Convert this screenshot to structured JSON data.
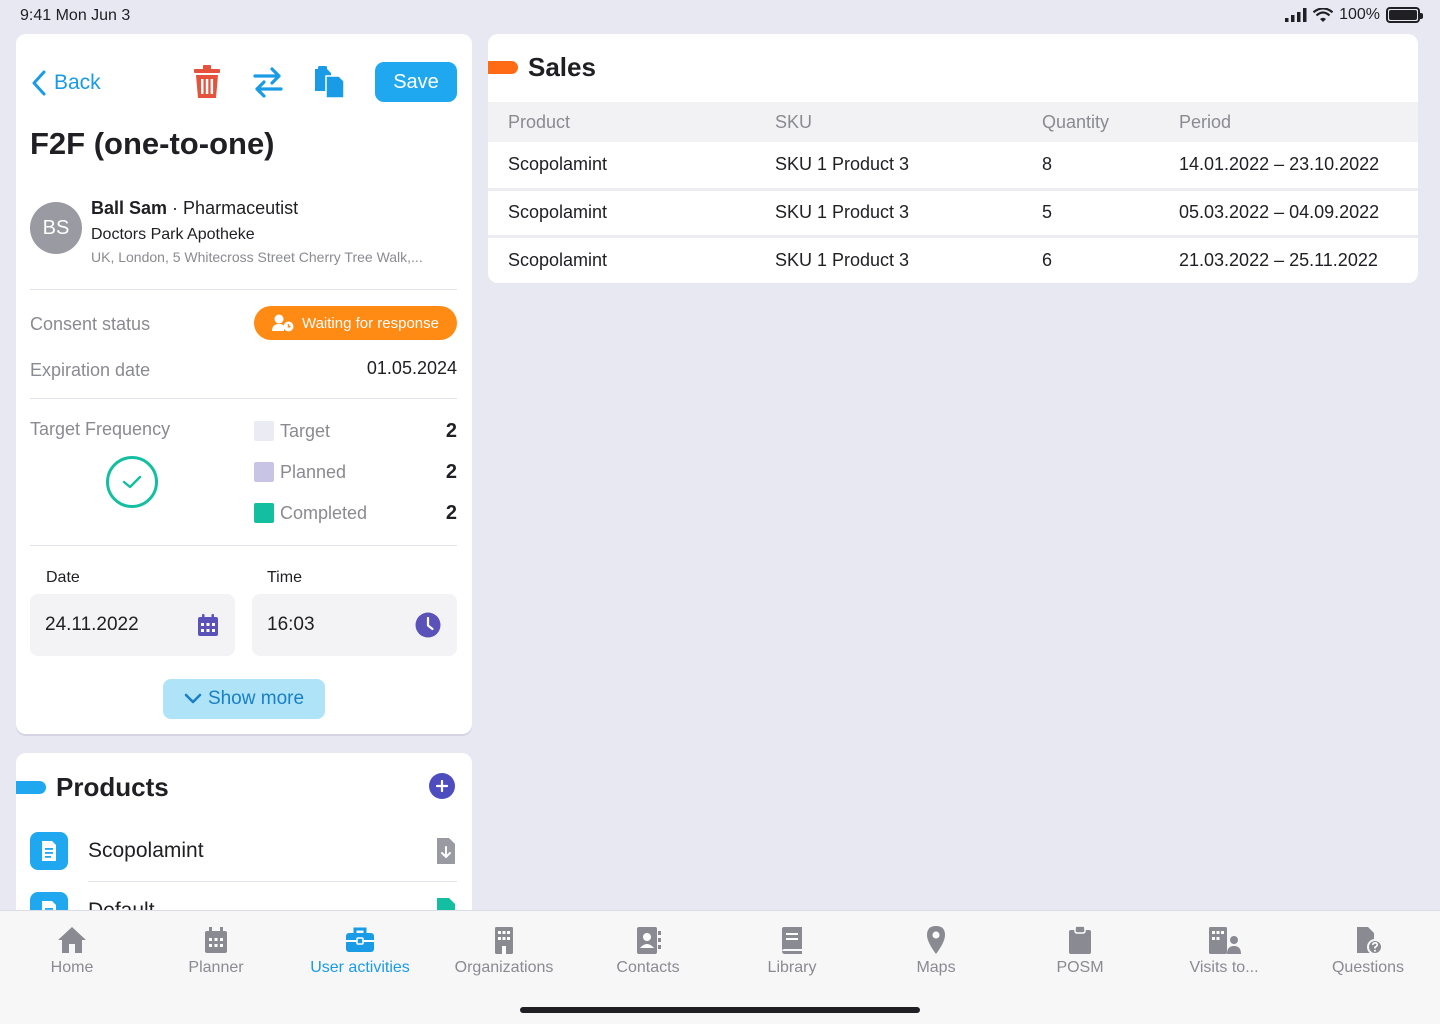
{
  "status_bar": {
    "time": "9:41  Mon Jun 3",
    "battery": "100%"
  },
  "visit": {
    "back_label": "Back",
    "save_label": "Save",
    "title": "F2F (one-to-one)",
    "contact": {
      "initials": "BS",
      "name": "Ball Sam",
      "separator": " · ",
      "role": "Pharmaceutist",
      "organization": "Doctors Park Apotheke",
      "address": "UK, London, 5 Whitecross Street Cherry Tree Walk,..."
    },
    "consent_label": "Consent status",
    "consent_value": "Waiting for response",
    "expiration_label": "Expiration date",
    "expiration_value": "01.05.2024",
    "frequency": {
      "label": "Target Frequency",
      "items": [
        {
          "label": "Target",
          "value": "2",
          "color": "#ebebf3"
        },
        {
          "label": "Planned",
          "value": "2",
          "color": "#c7c4e6"
        },
        {
          "label": "Completed",
          "value": "2",
          "color": "#14bfa1"
        }
      ]
    },
    "date_label": "Date",
    "date_value": "24.11.2022",
    "time_label": "Time",
    "time_value": "16:03",
    "show_more_label": "Show more"
  },
  "products": {
    "title": "Products",
    "items": [
      {
        "name": "Scopolamint"
      },
      {
        "name": "Default"
      }
    ]
  },
  "sales": {
    "title": "Sales",
    "columns": [
      "Product",
      "SKU",
      "Quantity",
      "Period"
    ],
    "rows": [
      [
        "Scopolamint",
        "SKU 1 Product 3",
        "8",
        "14.01.2022 – 23.10.2022"
      ],
      [
        "Scopolamint",
        "SKU 1 Product 3",
        "5",
        "05.03.2022 – 04.09.2022"
      ],
      [
        "Scopolamint",
        "SKU 1 Product 3",
        "6",
        "21.03.2022 – 25.11.2022"
      ]
    ]
  },
  "nav": {
    "active": "User activities",
    "items": [
      {
        "label": "Home",
        "icon": "home-icon"
      },
      {
        "label": "Planner",
        "icon": "calendar-icon"
      },
      {
        "label": "User activities",
        "icon": "briefcase-icon"
      },
      {
        "label": "Organizations",
        "icon": "building-icon"
      },
      {
        "label": "Contacts",
        "icon": "contact-book-icon"
      },
      {
        "label": "Library",
        "icon": "book-icon"
      },
      {
        "label": "Maps",
        "icon": "map-pin-icon"
      },
      {
        "label": "POSM",
        "icon": "clipboard-icon"
      },
      {
        "label": "Visits to...",
        "icon": "building-user-icon"
      },
      {
        "label": "Questions",
        "icon": "document-question-icon"
      }
    ]
  },
  "colors": {
    "accent": "#1fa8f0",
    "orange": "#ff8a14",
    "teal": "#14bfa1",
    "indigo": "#4d4dbf",
    "delete": "#e5533d"
  }
}
